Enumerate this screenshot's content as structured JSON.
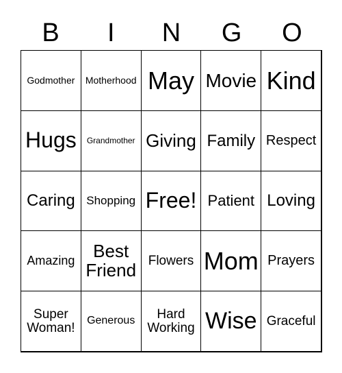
{
  "header": [
    "B",
    "I",
    "N",
    "G",
    "O"
  ],
  "cells": [
    {
      "text": "Godmother",
      "size": 14
    },
    {
      "text": "Motherhood",
      "size": 14
    },
    {
      "text": "May",
      "size": 36
    },
    {
      "text": "Movie",
      "size": 28
    },
    {
      "text": "Kind",
      "size": 36
    },
    {
      "text": "Hugs",
      "size": 32
    },
    {
      "text": "Grandmother",
      "size": 12
    },
    {
      "text": "Giving",
      "size": 26
    },
    {
      "text": "Family",
      "size": 24
    },
    {
      "text": "Respect",
      "size": 20
    },
    {
      "text": "Caring",
      "size": 24
    },
    {
      "text": "Shopping",
      "size": 17
    },
    {
      "text": "Free!",
      "size": 32
    },
    {
      "text": "Patient",
      "size": 22
    },
    {
      "text": "Loving",
      "size": 24
    },
    {
      "text": "Amazing",
      "size": 18
    },
    {
      "text": "Best Friend",
      "size": 26
    },
    {
      "text": "Flowers",
      "size": 19
    },
    {
      "text": "Mom",
      "size": 36
    },
    {
      "text": "Prayers",
      "size": 20
    },
    {
      "text": "Super Woman!",
      "size": 19
    },
    {
      "text": "Generous",
      "size": 16
    },
    {
      "text": "Hard Working",
      "size": 19
    },
    {
      "text": "Wise",
      "size": 34
    },
    {
      "text": "Graceful",
      "size": 19
    }
  ]
}
